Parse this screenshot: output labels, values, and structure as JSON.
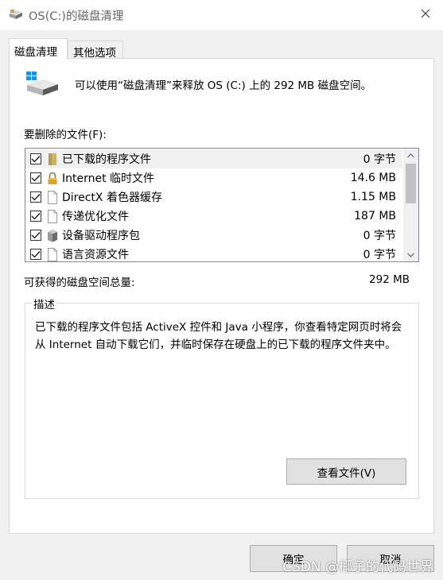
{
  "window": {
    "title": "OS(C:)的磁盘清理",
    "close_icon": "close-icon"
  },
  "tabs": [
    {
      "label": "磁盘清理",
      "active": true
    },
    {
      "label": "其他选项",
      "active": false
    }
  ],
  "intro": {
    "icon": "disk-drive-icon",
    "text": "可以使用“磁盘清理”来释放 OS (C:) 上的 292 MB 磁盘空间。"
  },
  "files_label": "要删除的文件(F):",
  "files": [
    {
      "name": "已下载的程序文件",
      "size": "0 字节",
      "checked": true,
      "icon": "folder-icon",
      "selected": true
    },
    {
      "name": "Internet 临时文件",
      "size": "14.6 MB",
      "checked": true,
      "icon": "lock-icon",
      "selected": false
    },
    {
      "name": "DirectX 着色器缓存",
      "size": "1.15 MB",
      "checked": true,
      "icon": "blank-file-icon",
      "selected": false
    },
    {
      "name": "传递优化文件",
      "size": "187 MB",
      "checked": true,
      "icon": "blank-file-icon",
      "selected": false
    },
    {
      "name": "设备驱动程序包",
      "size": "0 字节",
      "checked": true,
      "icon": "driver-package-icon",
      "selected": false
    },
    {
      "name": "语言资源文件",
      "size": "0 字节",
      "checked": true,
      "icon": "blank-file-icon",
      "selected": false
    }
  ],
  "total": {
    "label": "可获得的磁盘空间总量:",
    "value": "292 MB"
  },
  "description": {
    "legend": "描述",
    "text": "已下载的程序文件包括 ActiveX 控件和 Java 小程序，你查看特定网页时将会从 Internet 自动下载它们，并临时保存在硬盘上的已下载的程序文件夹中。",
    "view_files_label": "查看文件(V)"
  },
  "buttons": {
    "ok_label": "确定",
    "cancel_label": "取消"
  },
  "watermark": "CSDN @椰子的代码世界"
}
